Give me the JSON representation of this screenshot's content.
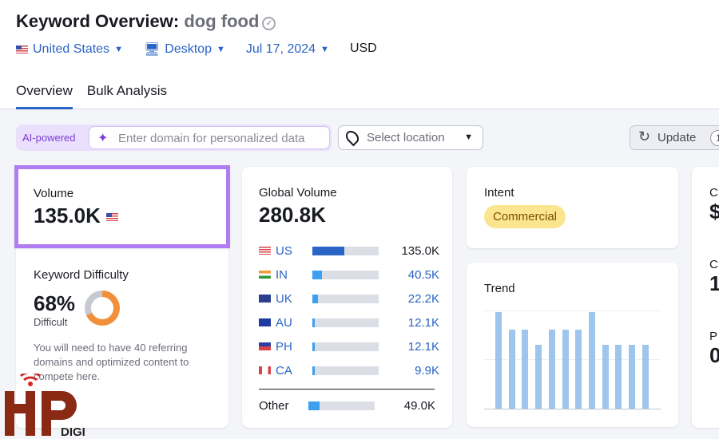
{
  "header": {
    "title": "Keyword Overview:",
    "keyword": "dog food",
    "filters": [
      {
        "label": "United States",
        "icon": "us-flag"
      },
      {
        "label": "Desktop",
        "icon": "monitor-icon"
      },
      {
        "label": "Jul 17, 2024"
      }
    ],
    "currency": "USD"
  },
  "tabs": [
    {
      "label": "Overview",
      "active": true
    },
    {
      "label": "Bulk Analysis"
    }
  ],
  "toolbar": {
    "ai_label": "AI-powered",
    "domain_placeholder": "Enter domain for personalized data",
    "location_placeholder": "Select location",
    "update_label": "Update",
    "update_badge": "1"
  },
  "volume": {
    "label": "Volume",
    "value": "135.0K"
  },
  "kd": {
    "label": "Keyword Difficulty",
    "value": "68%",
    "percent": 68,
    "level": "Difficult",
    "description": "You will need to have 40 referring domains and optimized content to compete here."
  },
  "global": {
    "label": "Global Volume",
    "value": "280.8K",
    "countries": [
      {
        "code": "US",
        "value": "135.0K",
        "share": 0.48
      },
      {
        "code": "IN",
        "value": "40.5K",
        "share": 0.14
      },
      {
        "code": "UK",
        "value": "22.2K",
        "share": 0.08
      },
      {
        "code": "AU",
        "value": "12.1K",
        "share": 0.04
      },
      {
        "code": "PH",
        "value": "12.1K",
        "share": 0.04
      },
      {
        "code": "CA",
        "value": "9.9K",
        "share": 0.035
      }
    ],
    "other": {
      "label": "Other",
      "value": "49.0K",
      "share": 0.17
    }
  },
  "intent": {
    "label": "Intent",
    "value": "Commercial"
  },
  "trend": {
    "label": "Trend",
    "relative_values": [
      1,
      0.82,
      0.82,
      0.66,
      0.82,
      0.82,
      0.82,
      1,
      0.66,
      0.66,
      0.66,
      0.66
    ]
  },
  "right_partial": {
    "labels": [
      "C",
      "C",
      "P"
    ],
    "values": [
      "$",
      "1",
      "0"
    ]
  },
  "watermark": {
    "text": "HP",
    "sub": "DIGI"
  },
  "colors": {
    "accent": "#2a64c4",
    "ai": "#7d3ed8",
    "highlight": "#b07cf2",
    "difficulty": "#f28f3b",
    "intent": "#fbe58f"
  }
}
